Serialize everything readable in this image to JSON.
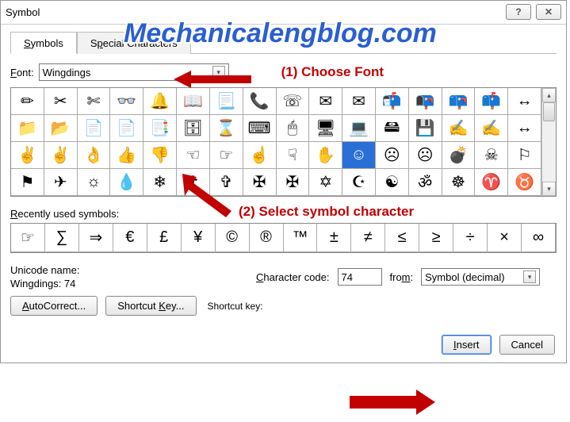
{
  "title": "Symbol",
  "watermark": "Mechanicalengblog.com",
  "tabs": {
    "symbols": "Symbols",
    "special": "Special Characters"
  },
  "font": {
    "label": "Font:",
    "value": "Wingdings"
  },
  "annotations": {
    "choose_font": "(1) Choose Font",
    "select_symbol": "(2) Select symbol character"
  },
  "grid": [
    "✏",
    "✂",
    "✄",
    "👓",
    "🔔",
    "📖",
    "📃",
    "📞",
    "☏",
    "✉",
    "✉",
    "📬",
    "📭",
    "📪",
    "📫",
    "↔",
    "📁",
    "📂",
    "📄",
    "📄",
    "📑",
    "🗄",
    "⌛",
    "⌨",
    "🖱",
    "🖥",
    "💻",
    "🖴",
    "💾",
    "✍",
    "✍",
    "↔",
    "✌",
    "✌",
    "👌",
    "👍",
    "👎",
    "☜",
    "☞",
    "☝",
    "☟",
    "✋",
    "☺",
    "☹",
    "☹",
    "💣",
    "☠",
    "⚐",
    "⚑",
    "✈",
    "☼",
    "💧",
    "❄",
    "✝",
    "✞",
    "✠",
    "✠",
    "✡",
    "☪",
    "☯",
    "ॐ",
    "☸",
    "♈",
    "♉"
  ],
  "selected_index": 42,
  "recent": {
    "label": "Recently used symbols:",
    "items": [
      "☞",
      "∑",
      "⇒",
      "€",
      "£",
      "¥",
      "©",
      "®",
      "™",
      "±",
      "≠",
      "≤",
      "≥",
      "÷",
      "×",
      "∞"
    ]
  },
  "unicode_name_label": "Unicode name:",
  "unicode_name": "Wingdings: 74",
  "char_code": {
    "label": "Character code:",
    "value": "74"
  },
  "from": {
    "label": "from:",
    "value": "Symbol (decimal)"
  },
  "buttons": {
    "autocorrect": "AutoCorrect...",
    "shortcut_key": "Shortcut Key...",
    "shortcut_label": "Shortcut key:",
    "insert": "Insert",
    "cancel": "Cancel"
  }
}
